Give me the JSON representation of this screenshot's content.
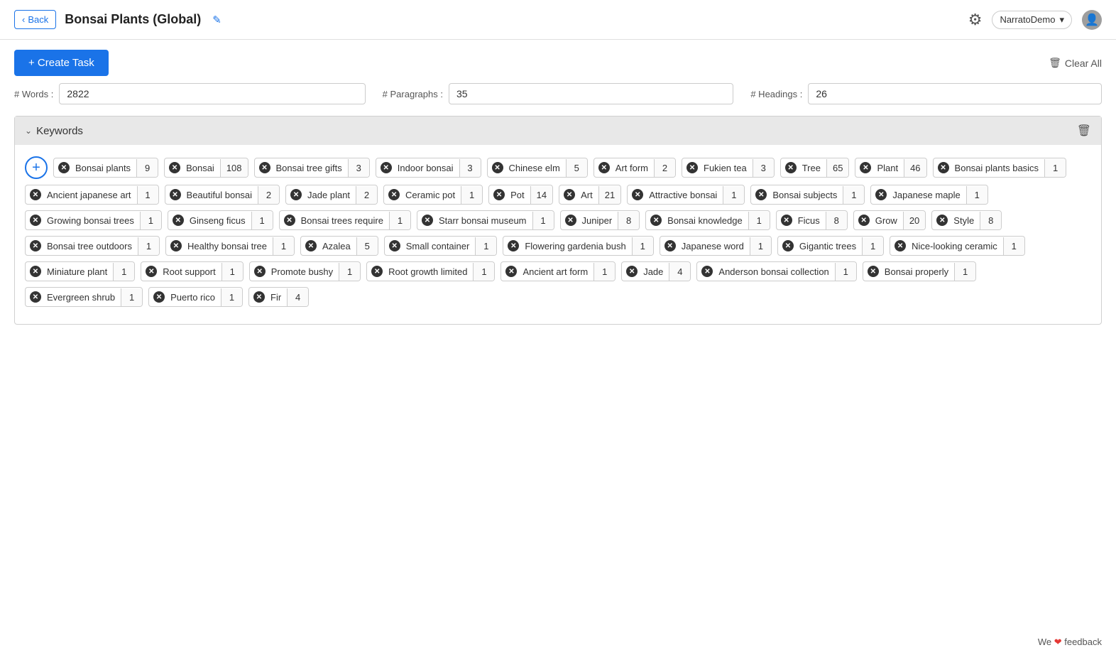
{
  "header": {
    "back_label": "Back",
    "title": "Bonsai Plants (Global)",
    "edit_icon": "✎",
    "settings_icon": "⚙",
    "user_name": "NarratoDemo",
    "user_chevron": "▾"
  },
  "toolbar": {
    "create_task_label": "+ Create Task",
    "clear_all_label": "Clear All"
  },
  "stats": {
    "words_label": "# Words :",
    "words_value": "2822",
    "paragraphs_label": "# Paragraphs :",
    "paragraphs_value": "35",
    "headings_label": "# Headings :",
    "headings_value": "26"
  },
  "keywords_section": {
    "title": "Keywords",
    "keywords": [
      {
        "name": "Bonsai plants",
        "count": "9"
      },
      {
        "name": "Bonsai",
        "count": "108"
      },
      {
        "name": "Bonsai tree gifts",
        "count": "3"
      },
      {
        "name": "Indoor bonsai",
        "count": "3"
      },
      {
        "name": "Chinese elm",
        "count": "5"
      },
      {
        "name": "Art form",
        "count": "2"
      },
      {
        "name": "Fukien tea",
        "count": "3"
      },
      {
        "name": "Tree",
        "count": "65"
      },
      {
        "name": "Plant",
        "count": "46"
      },
      {
        "name": "Bonsai plants basics",
        "count": "1"
      },
      {
        "name": "Ancient japanese art",
        "count": "1"
      },
      {
        "name": "Beautiful bonsai",
        "count": "2"
      },
      {
        "name": "Jade plant",
        "count": "2"
      },
      {
        "name": "Ceramic pot",
        "count": "1"
      },
      {
        "name": "Pot",
        "count": "14"
      },
      {
        "name": "Art",
        "count": "21"
      },
      {
        "name": "Attractive bonsai",
        "count": "1"
      },
      {
        "name": "Bonsai subjects",
        "count": "1"
      },
      {
        "name": "Japanese maple",
        "count": "1"
      },
      {
        "name": "Growing bonsai trees",
        "count": "1"
      },
      {
        "name": "Ginseng ficus",
        "count": "1"
      },
      {
        "name": "Bonsai trees require",
        "count": "1"
      },
      {
        "name": "Starr bonsai museum",
        "count": "1"
      },
      {
        "name": "Juniper",
        "count": "8"
      },
      {
        "name": "Bonsai knowledge",
        "count": "1"
      },
      {
        "name": "Ficus",
        "count": "8"
      },
      {
        "name": "Grow",
        "count": "20"
      },
      {
        "name": "Style",
        "count": "8"
      },
      {
        "name": "Bonsai tree outdoors",
        "count": "1"
      },
      {
        "name": "Healthy bonsai tree",
        "count": "1"
      },
      {
        "name": "Azalea",
        "count": "5"
      },
      {
        "name": "Small container",
        "count": "1"
      },
      {
        "name": "Flowering gardenia bush",
        "count": "1"
      },
      {
        "name": "Japanese word",
        "count": "1"
      },
      {
        "name": "Gigantic trees",
        "count": "1"
      },
      {
        "name": "Nice-looking ceramic",
        "count": "1"
      },
      {
        "name": "Miniature plant",
        "count": "1"
      },
      {
        "name": "Root support",
        "count": "1"
      },
      {
        "name": "Promote bushy",
        "count": "1"
      },
      {
        "name": "Root growth limited",
        "count": "1"
      },
      {
        "name": "Ancient art form",
        "count": "1"
      },
      {
        "name": "Jade",
        "count": "4"
      },
      {
        "name": "Anderson bonsai collection",
        "count": "1"
      },
      {
        "name": "Bonsai properly",
        "count": "1"
      },
      {
        "name": "Evergreen shrub",
        "count": "1"
      },
      {
        "name": "Puerto rico",
        "count": "1"
      },
      {
        "name": "Fir",
        "count": "4"
      }
    ]
  },
  "feedback": {
    "text": "We",
    "heart": "❤",
    "text2": "feedback"
  }
}
